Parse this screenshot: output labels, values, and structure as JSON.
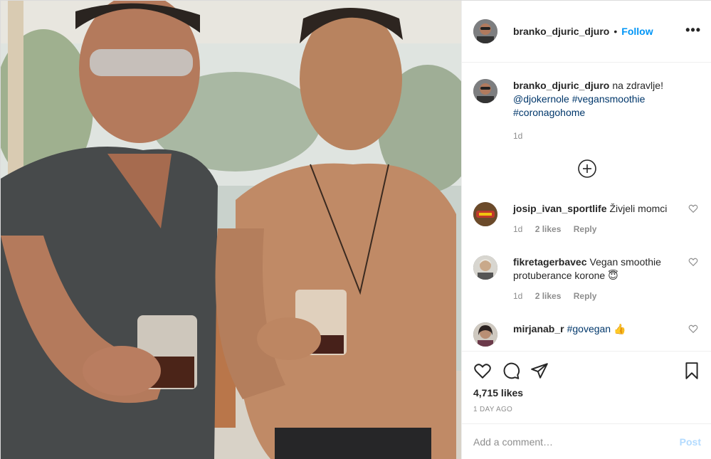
{
  "post": {
    "username": "branko_djuric_djuro",
    "separator": "•",
    "follow_label": "Follow",
    "more_label": "•••",
    "caption": {
      "username": "branko_djuric_djuro",
      "text": "na zdravlje!",
      "mention": "@djokernole",
      "hashtag1": "#vegansmoothie",
      "hashtag2": "#coronagohome",
      "time": "1d"
    },
    "load_more_icon": "plus-circle-icon",
    "comments": [
      {
        "username": "josip_ivan_sportlife",
        "text": "Živjeli momci",
        "time": "1d",
        "likes": "2 likes",
        "reply": "Reply"
      },
      {
        "username": "fikretagerbavec",
        "text": "Vegan smoothie protuberance korone 😇",
        "time": "1d",
        "likes": "2 likes",
        "reply": "Reply"
      },
      {
        "username": "mirjanab_r",
        "text": "",
        "hashtag": "#govegan",
        "emoji": "👍"
      }
    ],
    "likes": "4,715 likes",
    "posted": "1 DAY AGO",
    "comment_placeholder": "Add a comment…",
    "post_label": "Post",
    "colors": {
      "link": "#0095f6",
      "tag": "#00376b",
      "muted": "#8e8e8e",
      "post_disabled": "#b3dbff"
    }
  }
}
